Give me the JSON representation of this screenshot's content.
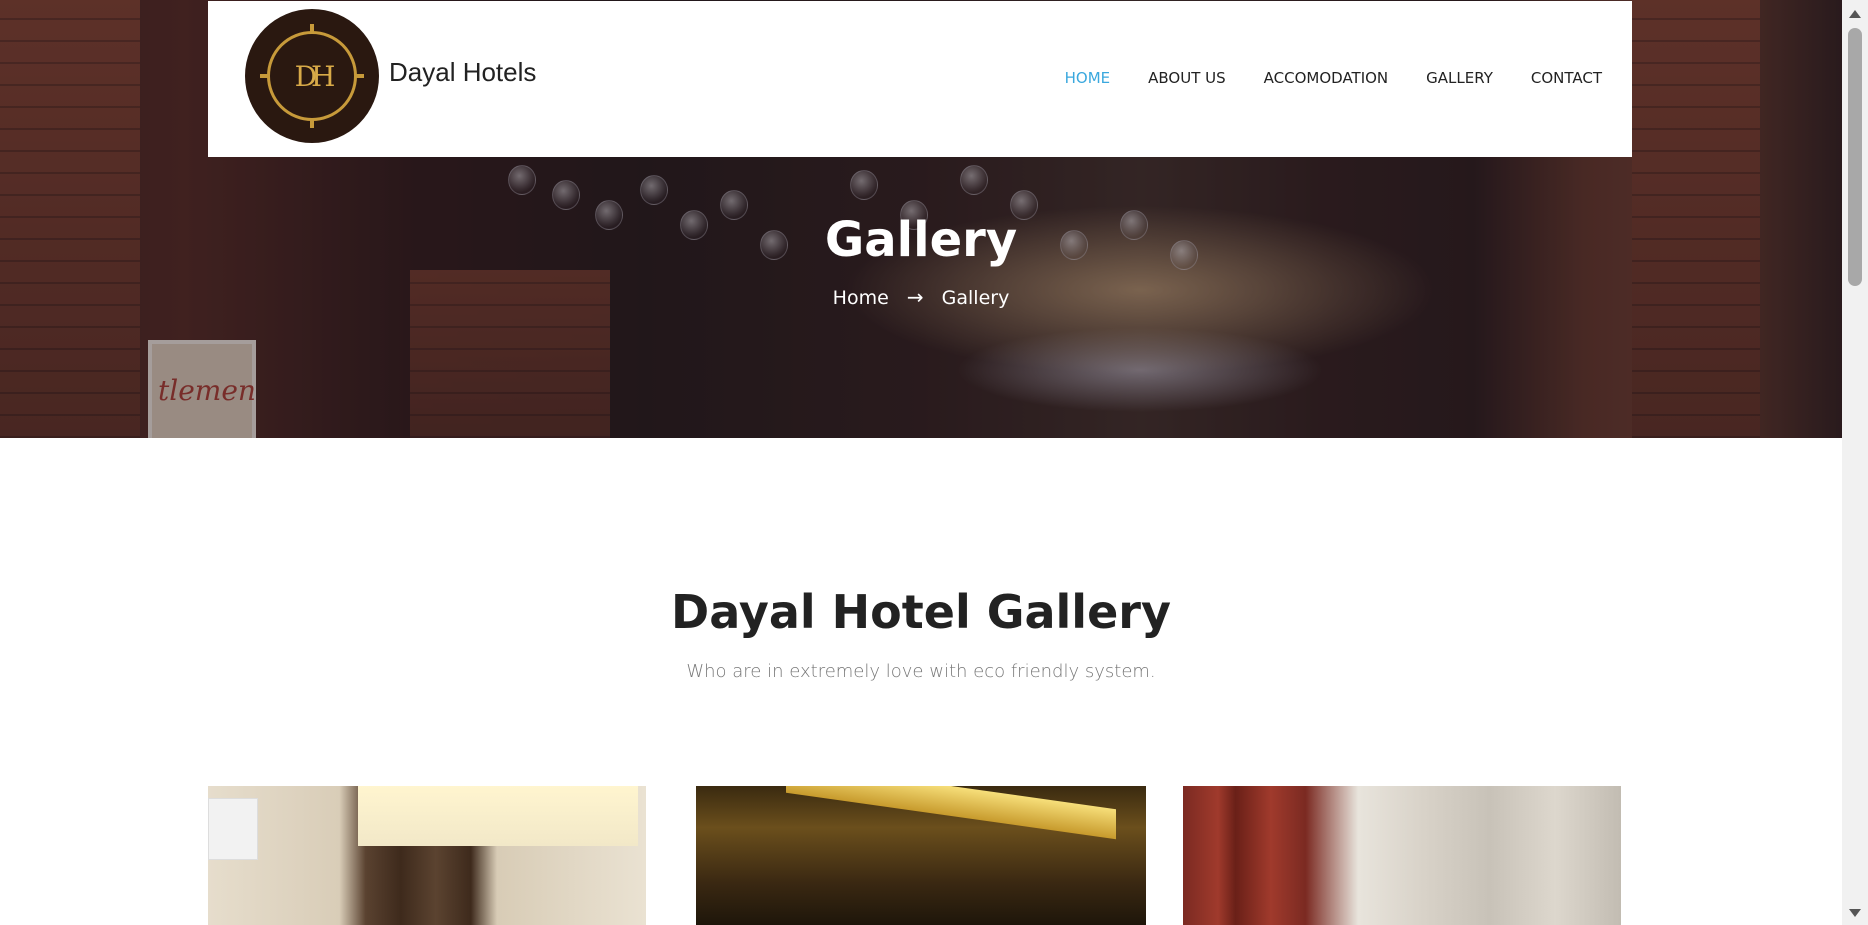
{
  "header": {
    "brand_name": "Dayal Hotels",
    "logo_monogram": "DH",
    "nav": [
      {
        "label": "HOME",
        "active": true
      },
      {
        "label": "ABOUT US",
        "active": false
      },
      {
        "label": "ACCOMODATION",
        "active": false
      },
      {
        "label": "GALLERY",
        "active": false
      },
      {
        "label": "CONTACT",
        "active": false
      }
    ]
  },
  "hero": {
    "title": "Gallery",
    "breadcrumb": {
      "home": "Home",
      "separator_icon": "arrow-right-icon",
      "current": "Gallery"
    }
  },
  "section": {
    "title": "Dayal Hotel Gallery",
    "subtitle": "Who are in extremely love with eco friendly system."
  },
  "gallery": {
    "images": [
      {
        "alt": "hotel-room-1"
      },
      {
        "alt": "hotel-room-2"
      },
      {
        "alt": "hotel-room-3"
      }
    ]
  },
  "colors": {
    "nav_active": "#3aa8de",
    "text_dark": "#222222",
    "text_muted": "#777777",
    "logo_bg": "#2a1810",
    "logo_gold": "#c79a3a"
  }
}
